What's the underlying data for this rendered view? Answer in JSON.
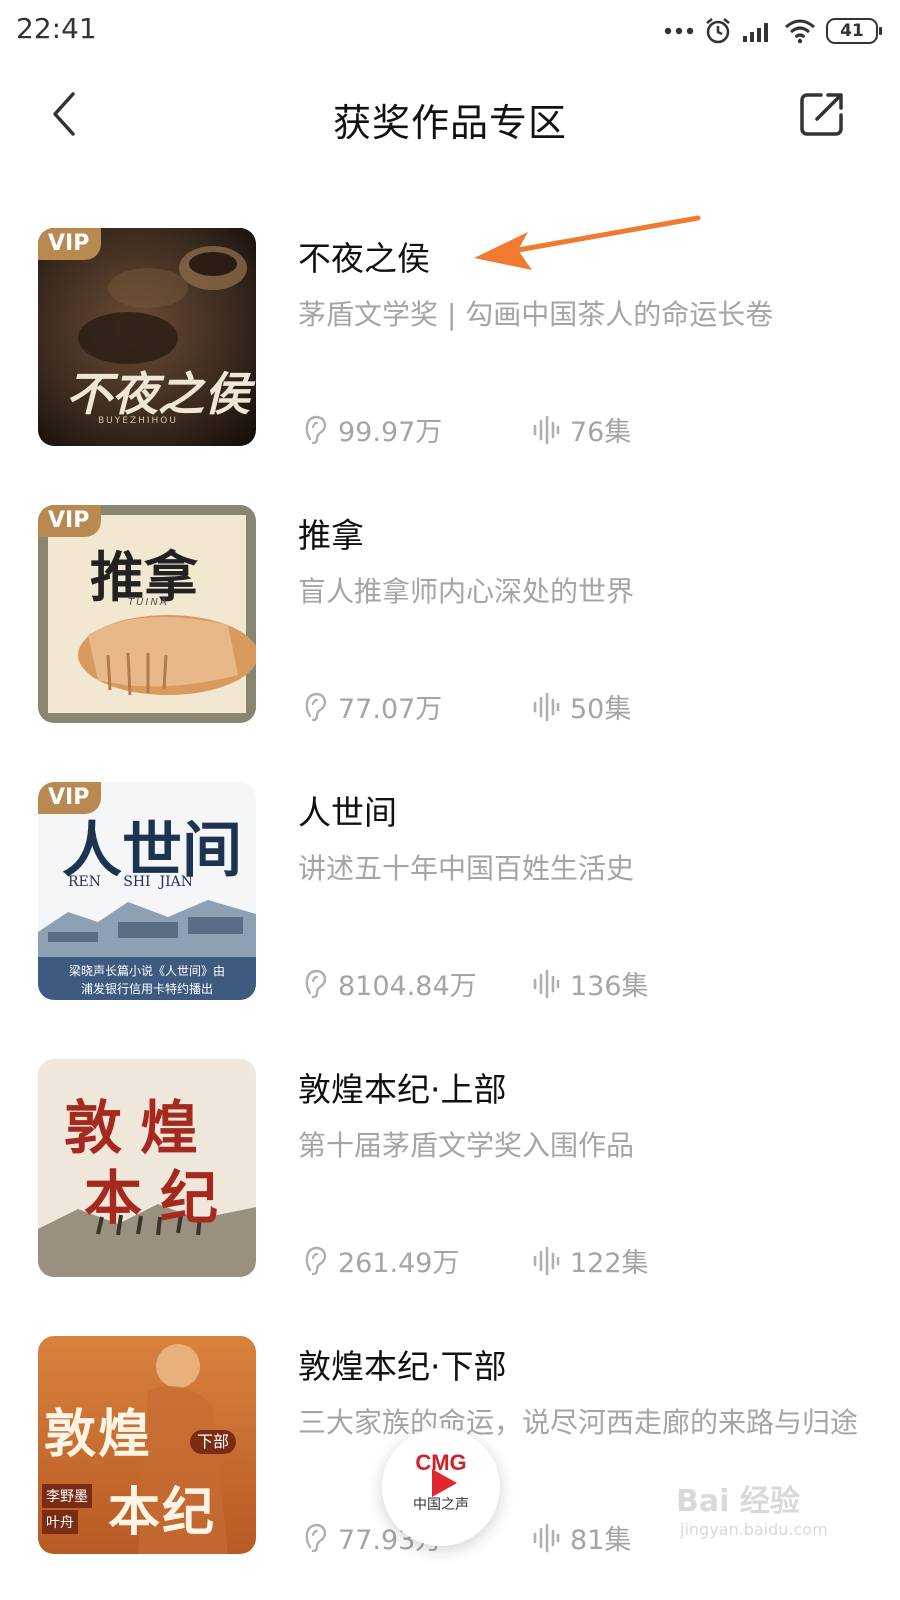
{
  "status_bar": {
    "time": "22:41",
    "battery": "41",
    "icons": [
      "more-dots-icon",
      "alarm-icon",
      "signal-icon",
      "wifi-icon",
      "battery-icon"
    ]
  },
  "header": {
    "title": "获奖作品专区",
    "back_icon": "chevron-left-icon",
    "share_icon": "share-icon"
  },
  "items": [
    {
      "title": "不夜之侯",
      "description": "茅盾文学奖 | 勾画中国茶人的命运长卷",
      "plays": "99.97万",
      "episodes": "76集",
      "vip": "VIP",
      "cover_text": "不夜之侯",
      "cover_sub": "BUYEZHIHOU"
    },
    {
      "title": "推拿",
      "description": "盲人推拿师内心深处的世界",
      "plays": "77.07万",
      "episodes": "50集",
      "vip": "VIP",
      "cover_text": "推拿",
      "cover_sub": "TUINA"
    },
    {
      "title": "人世间",
      "description": "讲述五十年中国百姓生活史",
      "plays": "8104.84万",
      "episodes": "136集",
      "vip": "VIP",
      "cover_text": "人世间",
      "cover_sub": "REN     SHI  JIAN",
      "cover_caption_1": "梁晓声长篇小说《人世间》由",
      "cover_caption_2": "浦发银行信用卡特约播出"
    },
    {
      "title": "敦煌本纪·上部",
      "description": "第十届茅盾文学奖入围作品",
      "plays": "261.49万",
      "episodes": "122集",
      "cover_text_1": "敦煌",
      "cover_text_2": "本纪"
    },
    {
      "title": "敦煌本纪·下部",
      "description": "三大家族的命运，说尽河西走廊的来路与归途",
      "plays": "77.93万",
      "episodes": "81集",
      "cover_text_1": "敦煌",
      "cover_text_2": "本纪",
      "cover_tag": "下部",
      "cover_author_1": "李野墨",
      "cover_author_2": "叶舟"
    }
  ],
  "float_player": {
    "brand": "CMG",
    "label": "中国之声"
  },
  "watermark": {
    "text": "Bai 经验",
    "url": "jingyan.baidu.com"
  },
  "colors": {
    "accent_arrow": "#f07b30",
    "vip_badge": "#b88a52",
    "muted_text": "#a5a5a5"
  }
}
